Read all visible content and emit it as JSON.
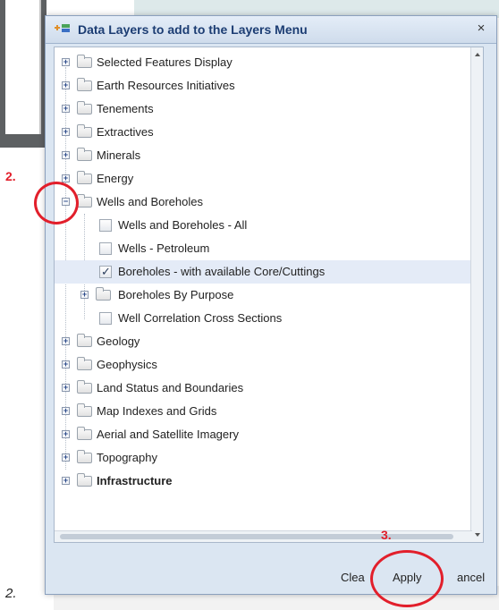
{
  "dialog": {
    "title": "Data Layers to add to the Layers Menu",
    "close_symbol": "×"
  },
  "tree": [
    {
      "label": "Selected Features Display",
      "type": "folder",
      "expanded": false,
      "level": 0
    },
    {
      "label": "Earth Resources Initiatives",
      "type": "folder",
      "expanded": false,
      "level": 0
    },
    {
      "label": "Tenements",
      "type": "folder",
      "expanded": false,
      "level": 0
    },
    {
      "label": "Extractives",
      "type": "folder",
      "expanded": false,
      "level": 0
    },
    {
      "label": "Minerals",
      "type": "folder",
      "expanded": false,
      "level": 0
    },
    {
      "label": "Energy",
      "type": "folder",
      "expanded": false,
      "level": 0
    },
    {
      "label": "Wells and Boreholes",
      "type": "folder",
      "expanded": true,
      "level": 0
    },
    {
      "label": "Wells and Boreholes - All",
      "type": "layer",
      "checked": false,
      "level": 1
    },
    {
      "label": "Wells - Petroleum",
      "type": "layer",
      "checked": false,
      "level": 1
    },
    {
      "label": "Boreholes - with available Core/Cuttings",
      "type": "layer",
      "checked": true,
      "level": 1
    },
    {
      "label": "Boreholes By Purpose",
      "type": "folder",
      "expanded": false,
      "level": 1
    },
    {
      "label": "Well Correlation Cross Sections",
      "type": "layer",
      "checked": false,
      "level": 1
    },
    {
      "label": "Geology",
      "type": "folder",
      "expanded": false,
      "level": 0
    },
    {
      "label": "Geophysics",
      "type": "folder",
      "expanded": false,
      "level": 0
    },
    {
      "label": "Land Status and Boundaries",
      "type": "folder",
      "expanded": false,
      "level": 0
    },
    {
      "label": "Map Indexes and Grids",
      "type": "folder",
      "expanded": false,
      "level": 0
    },
    {
      "label": "Aerial and Satellite Imagery",
      "type": "folder",
      "expanded": false,
      "level": 0
    },
    {
      "label": "Topography",
      "type": "folder",
      "expanded": false,
      "level": 0
    },
    {
      "label": "Infrastructure",
      "type": "folder",
      "expanded": false,
      "level": 0,
      "bold": true
    }
  ],
  "buttons": {
    "clear": "Clea",
    "apply": "Apply",
    "cancel": "ancel"
  },
  "annotations": {
    "step2": "2.",
    "step3": "3.",
    "page_label": "2."
  },
  "colors": {
    "annotation": "#e21f2b",
    "title_text": "#1c3d73",
    "selected_row": "#e4ebf7"
  }
}
